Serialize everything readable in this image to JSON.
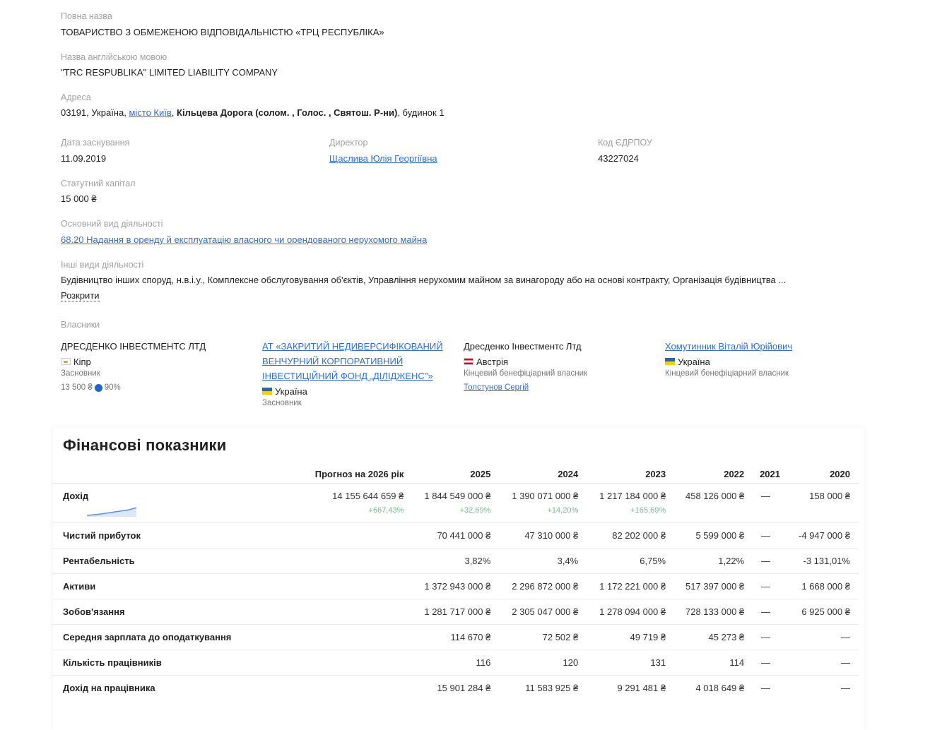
{
  "company": {
    "full_name_label": "Повна назва",
    "full_name": "ТОВАРИСТВО З ОБМЕЖЕНОЮ ВІДПОВІДАЛЬНІСТЮ «ТРЦ РЕСПУБЛІКА»",
    "english_name_label": "Назва англійською мовою",
    "english_name": "\"TRC RESPUBLIKA\" LIMITED LIABILITY COMPANY",
    "address_label": "Адреса",
    "address_prefix": "03191, Україна, ",
    "address_city_link": "місто Київ",
    "address_street": "Кільцева Дорога (солом. , Голос. , Святош. Р-ни)",
    "address_suffix": ", будинок 1",
    "founded_label": "Дата заснування",
    "founded": "11.09.2019",
    "director_label": "Директор",
    "director": "Щаслива Юлія Георгіївна",
    "edrpou_label": "Код ЄДРПОУ",
    "edrpou": "43227024",
    "capital_label": "Статутний капітал",
    "capital": "15 000 ₴",
    "main_activity_label": "Основний вид діяльності",
    "main_activity": "68.20 Надання в оренду й експлуатацію власного чи орендованого нерухомого майна",
    "other_activities_label": "Інші види діяльності",
    "other_activities": "Будівництво інших споруд, н.в.і.у., Комплексне обслуговування об'єктів, Управління нерухомим майном за винагороду або на основі контракту, Організація будівництва ...",
    "expand_label": "Розкрити"
  },
  "owners": {
    "label": "Власники",
    "items": [
      {
        "name_line1": "ДРЕСДЕНКО ІНВЕСТМЕНТС ЛТД",
        "name_line2": "",
        "name_line3": "",
        "country": "Кіпр",
        "flag": "cy",
        "role": "Засновник",
        "share_amount": "13 500 ₴",
        "share_pct": "90%"
      },
      {
        "name_line1": "АТ «ЗАКРИТИЙ НЕДИВЕРСИФІКОВАНИЙ",
        "name_line2": "ВЕНЧУРНИЙ КОРПОРАТИВНИЙ",
        "name_line3": "ІНВЕСТИЦІЙНИЙ ФОНД „ДІЛІДЖЕНС\"»",
        "country": "Україна",
        "flag": "ua",
        "role": "Засновник"
      },
      {
        "name_line1": "Дресденко Інвестментс Лтд",
        "country": "Австрія",
        "flag": "at",
        "role": "Кінцевий бенефіціарний власник",
        "linked_person": "Толстунов Сергій"
      },
      {
        "name_line1": "Хомутинник Віталій Юрійович",
        "country": "Україна",
        "flag": "ua",
        "role": "Кінцевий бенефіціарний власник"
      }
    ]
  },
  "finance": {
    "title": "Фінансові показники",
    "columns": [
      "Прогноз на 2026 рік",
      "2025",
      "2024",
      "2023",
      "2022",
      "2021",
      "2020"
    ],
    "rows": [
      {
        "label": "Дохід",
        "values": [
          "14 155 644 659 ₴",
          "1 844 549 000 ₴",
          "1 390 071 000 ₴",
          "1 217 184 000 ₴",
          "458 126 000 ₴",
          "—",
          "158 000 ₴"
        ],
        "changes": [
          "+667,43%",
          "+32,69%",
          "+14,20%",
          "+165,69%"
        ]
      },
      {
        "label": "Чистий прибуток",
        "values": [
          "",
          "70 441 000 ₴",
          "47 310 000 ₴",
          "82 202 000 ₴",
          "5 599 000 ₴",
          "—",
          "-4 947 000 ₴"
        ]
      },
      {
        "label": "Рентабельність",
        "values": [
          "",
          "3,82%",
          "3,4%",
          "6,75%",
          "1,22%",
          "—",
          "-3 131,01%"
        ]
      },
      {
        "label": "Активи",
        "values": [
          "",
          "1 372 943 000 ₴",
          "2 296 872 000 ₴",
          "1 172 221 000 ₴",
          "517 397 000 ₴",
          "—",
          "1 668 000 ₴"
        ]
      },
      {
        "label": "Зобов'язання",
        "values": [
          "",
          "1 281 717 000 ₴",
          "2 305 047 000 ₴",
          "1 278 094 000 ₴",
          "728 133 000 ₴",
          "—",
          "6 925 000 ₴"
        ]
      },
      {
        "label": "Середня зарплата до оподаткування",
        "values": [
          "",
          "114 670 ₴",
          "72 502 ₴",
          "49 719 ₴",
          "45 273 ₴",
          "—",
          "—"
        ]
      },
      {
        "label": "Кількість працівників",
        "values": [
          "",
          "116",
          "120",
          "131",
          "114",
          "—",
          "—"
        ]
      },
      {
        "label": "Дохід на працівника",
        "values": [
          "",
          "15 901 284 ₴",
          "11 583 925 ₴",
          "9 291 481 ₴",
          "4 018 649 ₴",
          "—",
          "—"
        ]
      }
    ],
    "sparkline_color": "#5b8def",
    "change_color": "#6fbf8a"
  }
}
